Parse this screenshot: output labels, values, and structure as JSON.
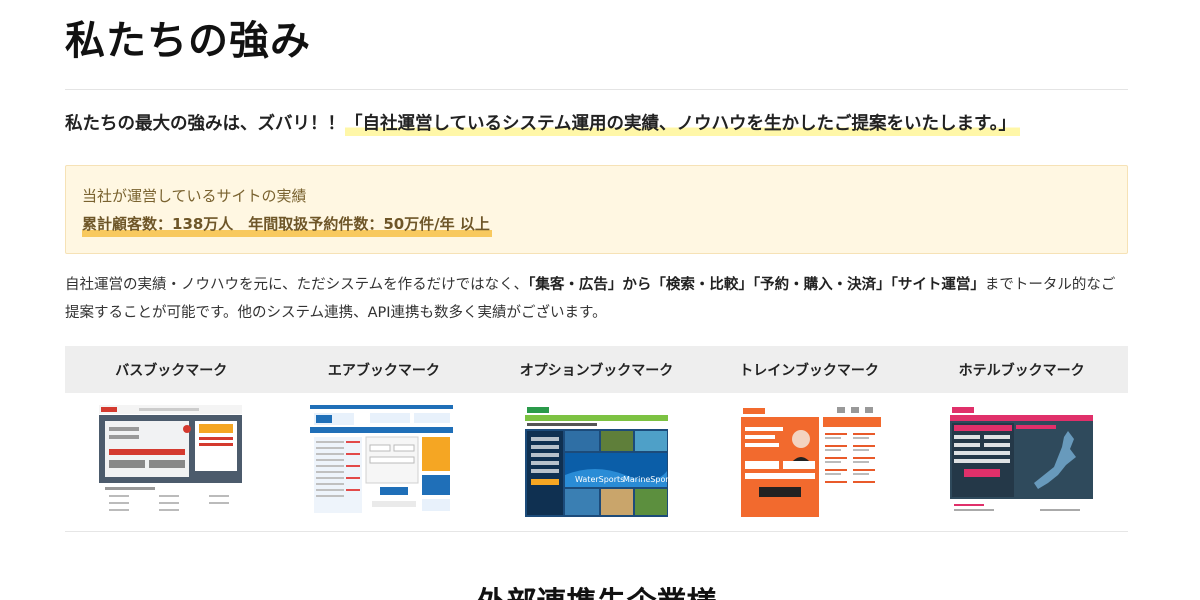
{
  "page": {
    "title": "私たちの強み"
  },
  "lead": {
    "prefix": "私たちの最大の強みは、ズバリ！！",
    "highlight": "「自社運営しているシステム運用の実績、ノウハウを生かしたご提案をいたします。」"
  },
  "notice": {
    "heading": "当社が運営しているサイトの実績",
    "figures": "累計顧客数：138万人　年間取扱予約件数：50万件/年 以上"
  },
  "body": {
    "part1": "自社運営の実績・ノウハウを元に、ただシステムを作るだけではなく、",
    "bold1": "「集客・広告」から「検索・比較」「予約・購入・決済」「サイト運営」",
    "part2": "までトータル的なご提案することが可能です。他のシステム連携、API連携も数多く実績がございます。"
  },
  "services": [
    {
      "label": "バスブックマーク",
      "thumb_icon": "bus-site-screenshot",
      "accent": "#d43a2f"
    },
    {
      "label": "エアブックマーク",
      "thumb_icon": "air-site-screenshot",
      "accent": "#1f6fb8"
    },
    {
      "label": "オプションブックマーク",
      "thumb_icon": "option-site-screenshot",
      "accent": "#2a9a4a",
      "thumb_text": [
        "WaterSports",
        "MarineSports"
      ]
    },
    {
      "label": "トレインブックマーク",
      "thumb_icon": "train-site-screenshot",
      "accent": "#f26a2e"
    },
    {
      "label": "ホテルブックマーク",
      "thumb_icon": "hotel-site-screenshot",
      "accent": "#e0306a"
    }
  ],
  "next_section": {
    "heading": "外部連携先企業様"
  }
}
